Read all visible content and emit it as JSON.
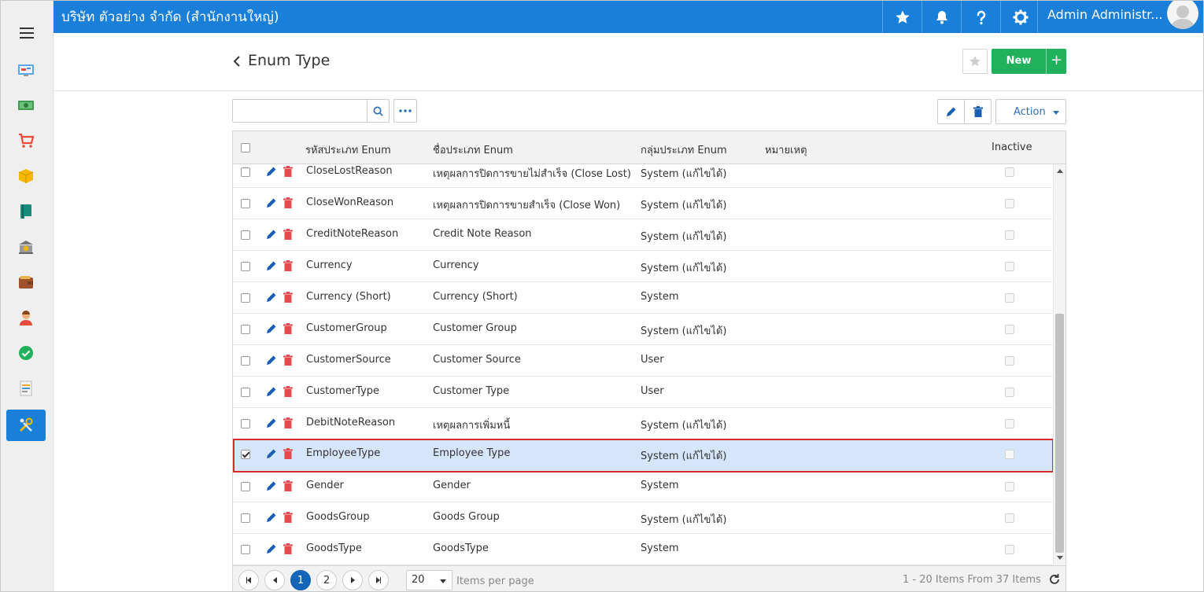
{
  "topbar": {
    "company": "บริษัท ตัวอย่าง จำกัด (สำนักงานใหญ่)",
    "user_name": "Admin Administr...",
    "icons": [
      "star-icon",
      "bell-icon",
      "help-icon",
      "gear-icon"
    ],
    "color": "#1a7fd8"
  },
  "sidebar": {
    "items": [
      {
        "name": "dashboard-icon"
      },
      {
        "name": "money-icon"
      },
      {
        "name": "cart-icon"
      },
      {
        "name": "box-icon"
      },
      {
        "name": "book-icon"
      },
      {
        "name": "bank-icon"
      },
      {
        "name": "wallet-icon"
      },
      {
        "name": "person-icon"
      },
      {
        "name": "check-circle-icon"
      },
      {
        "name": "report-icon"
      },
      {
        "name": "tools-icon",
        "active": true
      }
    ]
  },
  "page": {
    "title": "Enum Type",
    "new_label": "New",
    "new_plus": "+",
    "new_color": "#21b05c"
  },
  "toolbar": {
    "search_value": "",
    "action_label": "Action"
  },
  "table": {
    "columns": {
      "code": "รหัสประเภท Enum",
      "name": "ชื่อประเภท Enum",
      "group": "กลุ่มประเภท Enum",
      "remark": "หมายเหตุ",
      "inactive": "Inactive"
    },
    "rows": [
      {
        "code": "CloseLostReason",
        "name": "เหตุผลการปิดการขายไม่สำเร็จ (Close Lost)",
        "group": "System (แก้ไขได้)",
        "checked": false
      },
      {
        "code": "CloseWonReason",
        "name": "เหตุผลการปิดการขายสำเร็จ (Close Won)",
        "group": "System (แก้ไขได้)",
        "checked": false
      },
      {
        "code": "CreditNoteReason",
        "name": "Credit Note Reason",
        "group": "System (แก้ไขได้)",
        "checked": false
      },
      {
        "code": "Currency",
        "name": "Currency",
        "group": "System (แก้ไขได้)",
        "checked": false
      },
      {
        "code": "Currency (Short)",
        "name": "Currency (Short)",
        "group": "System",
        "checked": false
      },
      {
        "code": "CustomerGroup",
        "name": "Customer Group",
        "group": "System (แก้ไขได้)",
        "checked": false
      },
      {
        "code": "CustomerSource",
        "name": "Customer Source",
        "group": "User",
        "checked": false
      },
      {
        "code": "CustomerType",
        "name": "Customer Type",
        "group": "User",
        "checked": false
      },
      {
        "code": "DebitNoteReason",
        "name": "เหตุผลการเพิ่มหนี้",
        "group": "System (แก้ไขได้)",
        "checked": false
      },
      {
        "code": "EmployeeType",
        "name": "Employee Type",
        "group": "System (แก้ไขได้)",
        "checked": true,
        "selected": true
      },
      {
        "code": "Gender",
        "name": "Gender",
        "group": "System",
        "checked": false
      },
      {
        "code": "GoodsGroup",
        "name": "Goods Group",
        "group": "System (แก้ไขได้)",
        "checked": false
      },
      {
        "code": "GoodsType",
        "name": "GoodsType",
        "group": "System",
        "checked": false
      }
    ]
  },
  "pager": {
    "pages": [
      "1",
      "2"
    ],
    "current": "1",
    "per_page": "20",
    "per_page_label": "Items per page",
    "info": "1 - 20 Items From 37 Items"
  }
}
